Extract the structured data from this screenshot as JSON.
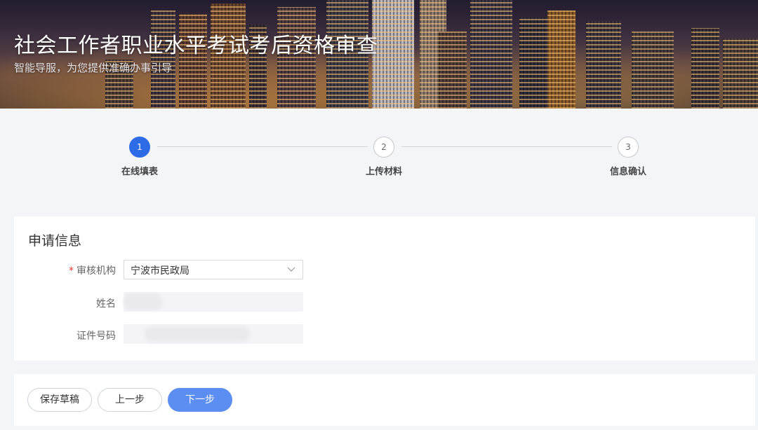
{
  "header": {
    "title": "社会工作者职业水平考试考后资格审查",
    "subtitle": "智能导服，为您提供准确办事引导"
  },
  "steps": [
    {
      "number": "1",
      "label": "在线填表",
      "state": "active"
    },
    {
      "number": "2",
      "label": "上传材料",
      "state": "todo"
    },
    {
      "number": "3",
      "label": "信息确认",
      "state": "todo"
    }
  ],
  "form": {
    "title": "申请信息",
    "fields": {
      "agency": {
        "required_mark": "*",
        "label": "审核机构",
        "value": "宁波市民政局",
        "icon": "chevron-down-icon"
      },
      "name": {
        "label": "姓名",
        "value": ""
      },
      "id_number": {
        "label": "证件号码",
        "value": ""
      }
    }
  },
  "actions": {
    "save_draft": "保存草稿",
    "prev": "上一步",
    "next": "下一步"
  },
  "colors": {
    "accent": "#2e6be6",
    "primary_button": "#5b8ef0",
    "required": "#e53935"
  }
}
